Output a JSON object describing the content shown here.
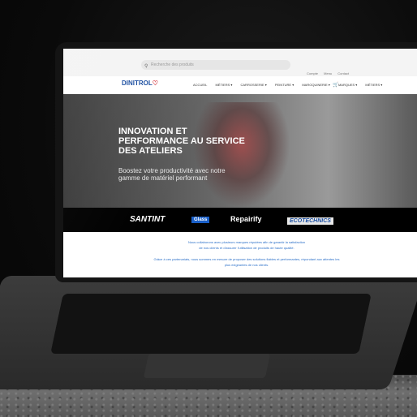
{
  "search": {
    "placeholder": "Recherche des produits"
  },
  "toplinks": [
    "Compte",
    "Menu",
    "Contact"
  ],
  "logo": {
    "text": "DINITROL"
  },
  "menu": [
    "ACCUEIL",
    "MÉTIERS ▾",
    "CARROSSERIE ▾",
    "PEINTURE ▾",
    "MAROQUINERIE ▾",
    "MARQUES ▾",
    "MÉTIERS ▾"
  ],
  "hero": {
    "title": "INNOVATION ET PERFORMANCE AU SERVICE DES ATELIERS",
    "subtitle": "Boostez votre productivité avec notre gamme de matériel performant"
  },
  "brands": [
    "SANTINT",
    "Glass",
    "Repairify",
    "ECOTECHNICS"
  ],
  "content": {
    "p1": "Nous collaborons avec plusieurs marques réputées afin de garantir la satisfaction",
    "p2": "de nos clients et d'assurer l'utilisation de produits de haute qualité.",
    "p3": "Grâce à ces partenariats, nous sommes en mesure de proposer des solutions fiables et performantes, répondant aux attentes les",
    "p4": "plus exigeantes de nos clients."
  }
}
